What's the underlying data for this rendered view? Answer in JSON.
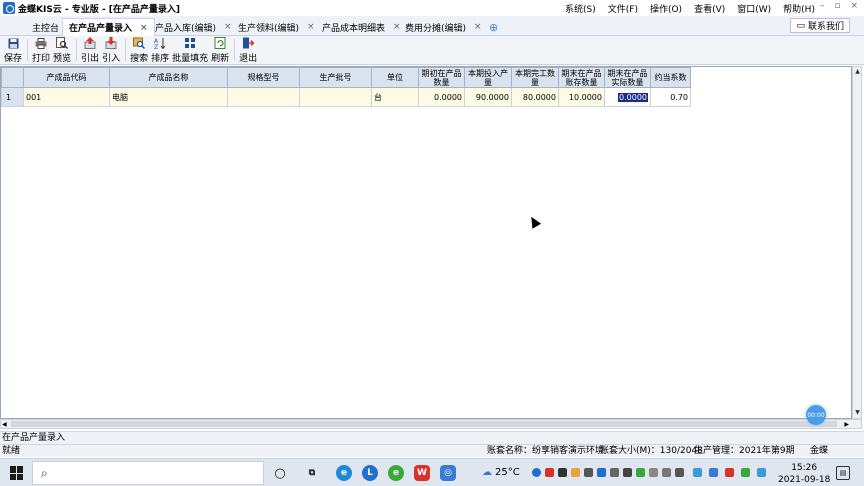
{
  "window": {
    "title": "金蝶KIS云 - 专业版 - [在产品产量录入]",
    "menus": [
      "系统(S)",
      "文件(F)",
      "操作(O)",
      "查看(V)",
      "窗口(W)",
      "帮助(H)"
    ]
  },
  "tabs": [
    {
      "label": "主控台",
      "closable": false,
      "active": false
    },
    {
      "label": "在产品产量录入",
      "closable": true,
      "active": true
    },
    {
      "label": "产品入库(编辑)",
      "closable": true,
      "active": false
    },
    {
      "label": "生产领料(编辑)",
      "closable": true,
      "active": false
    },
    {
      "label": "产品成本明细表",
      "closable": true,
      "active": false
    },
    {
      "label": "费用分摊(编辑)",
      "closable": true,
      "active": false
    }
  ],
  "contact_button": "联系我们",
  "toolbar": {
    "save": "保存",
    "print": "打印",
    "preview": "预览",
    "export": "引出",
    "import": "引入",
    "search": "搜索",
    "sort": "排序",
    "batch_fill": "批量填充",
    "refresh": "刷新",
    "exit": "退出"
  },
  "grid": {
    "headers": [
      "产成品代码",
      "产成品名称",
      "规格型号",
      "生产批号",
      "单位",
      "期初在产品数量",
      "本期投入产量",
      "本期完工数量",
      "期末在产品账存数量",
      "期末在产品实际数量",
      "约当系数"
    ],
    "rows": [
      {
        "no": "1",
        "code": "001",
        "name": "电脑",
        "spec": "",
        "batch": "",
        "unit": "台",
        "begin_qty": "0.0000",
        "input_qty": "90.0000",
        "finished_qty": "80.0000",
        "book_qty": "10.0000",
        "actual_qty": "0.0000",
        "factor": "0.70"
      }
    ]
  },
  "float_button": "00:00",
  "page_name": "在产品产量录入",
  "status": {
    "ready": "就绪",
    "account_name": "账套名称：纷享销客演示环境",
    "account_size": "账套大小(M)：130/2048",
    "period": "生产管理：2021年第9期",
    "user": "金蝶"
  },
  "taskbar": {
    "weather": "25°C",
    "time": "15:26",
    "date": "2021-09-18"
  }
}
